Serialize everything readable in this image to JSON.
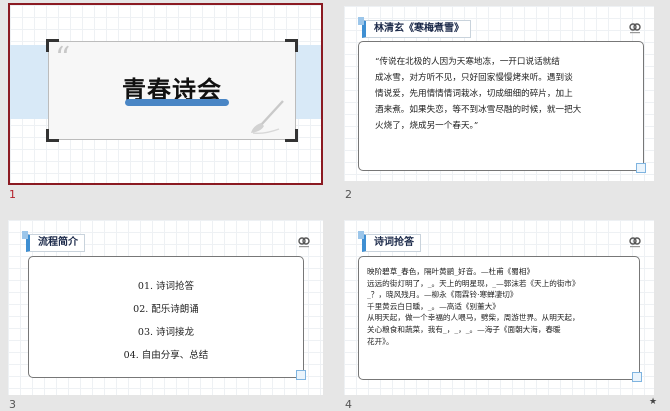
{
  "slides": [
    {
      "number": "1",
      "title": "青春诗会",
      "quote_glyph": "“"
    },
    {
      "number": "2",
      "header": "林清玄《寒梅煮雪》",
      "lines": [
        "“传说在北极的人因为天寒地冻，一开口说话就结",
        "成冰雪，对方听不见，只好回家慢慢烤来听。遇到谈",
        "情说爱，先用情情情词栽冰，切成细细的碎片，加上",
        "酒来煮。如果失恋，等不到冰雪尽融的时候，就一把大",
        "火烧了，烧成另一个春天。”"
      ]
    },
    {
      "number": "3",
      "header": "流程简介",
      "items": [
        "01. 诗词抢答",
        "02. 配乐诗朗诵",
        "03.  诗词接龙",
        "04. 自由分享、总结"
      ]
    },
    {
      "number": "4",
      "header": "诗词抢答",
      "lines": [
        "映阶碧草_春色，隔叶黄鹂_好音。—杜甫《蜀相》",
        "远远的街灯明了，_。天上的明星现，_—郭沫若《天上的街市》",
        "_？，晓风残月。—柳永《雨霖铃·寒蝉凄切》",
        "千里黄云白日曛，_。—高适《别董大》",
        "从明天起，做一个幸福的人喂马，劈柴，周游世界。从明天起，",
        "关心粮食和蔬菜，我有_，_，_。—海子《面朝大海，春暖",
        "花开》。"
      ]
    }
  ],
  "status": {
    "star_glyph": "★"
  },
  "colors": {
    "accent_blue": "#3f8fd2",
    "selection_border": "#8b1a22"
  },
  "icons": [
    "brush-icon",
    "logo-icon",
    "star-icon"
  ]
}
